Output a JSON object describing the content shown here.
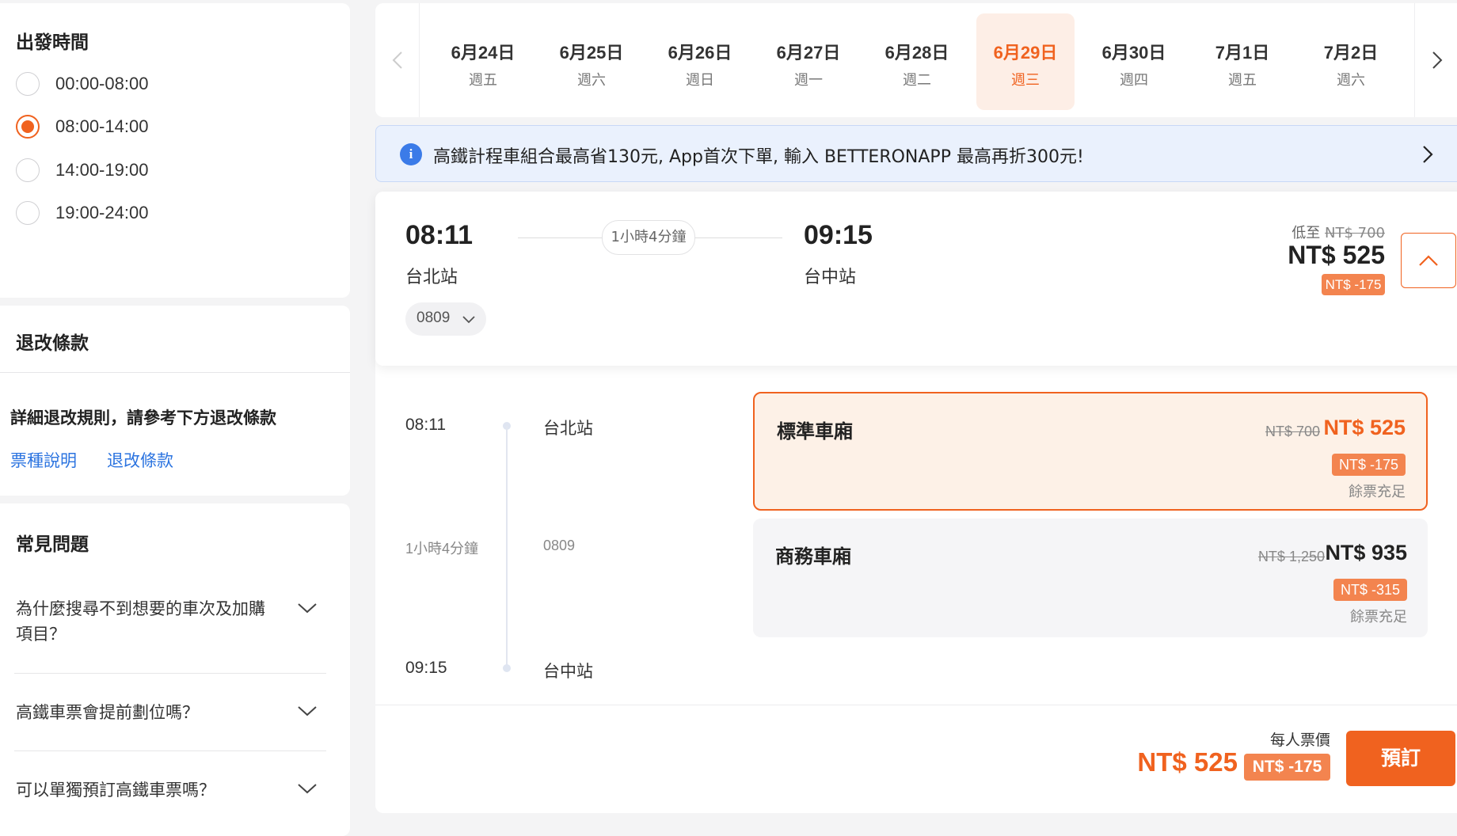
{
  "filters": {
    "departure": {
      "title": "出發時間",
      "options": [
        "00:00-08:00",
        "08:00-14:00",
        "14:00-19:00",
        "19:00-24:00"
      ],
      "selected_index": 1
    },
    "refund": {
      "title": "退改條款",
      "note": "詳細退改規則，請參考下方退改條款",
      "links": [
        "票種說明",
        "退改條款"
      ]
    },
    "faq": {
      "title": "常見問題",
      "questions": [
        "為什麼搜尋不到想要的車次及加購項目？",
        "高鐵車票會提前劃位嗎？",
        "可以單獨預訂高鐵車票嗎？"
      ]
    }
  },
  "dates": [
    {
      "date": "6月24日",
      "weekday": "週五"
    },
    {
      "date": "6月25日",
      "weekday": "週六"
    },
    {
      "date": "6月26日",
      "weekday": "週日"
    },
    {
      "date": "6月27日",
      "weekday": "週一"
    },
    {
      "date": "6月28日",
      "weekday": "週二"
    },
    {
      "date": "6月29日",
      "weekday": "週三"
    },
    {
      "date": "6月30日",
      "weekday": "週四"
    },
    {
      "date": "7月1日",
      "weekday": "週五"
    },
    {
      "date": "7月2日",
      "weekday": "週六"
    }
  ],
  "active_date_index": 5,
  "banner": {
    "text": "高鐵計程車組合最高省130元, App首次下單, 輸入 BETTERONAPP 最高再折300元!"
  },
  "train": {
    "depart_time": "08:11",
    "depart_station": "台北站",
    "arrive_time": "09:15",
    "arrive_station": "台中站",
    "duration": "1小時4分鐘",
    "train_no": "0809",
    "from_label": "低至",
    "original_price": "NT$ 700",
    "price": "NT$ 525",
    "discount": "NT$ -175"
  },
  "classes": [
    {
      "name": "標準車廂",
      "original": "NT$ 700",
      "price": "NT$ 525",
      "discount": "NT$ -175",
      "availability": "餘票充足"
    },
    {
      "name": "商務車廂",
      "original": "NT$ 1,250",
      "price": "NT$ 935",
      "discount": "NT$ -315",
      "availability": "餘票充足"
    }
  ],
  "footer": {
    "per_person_label": "每人票價",
    "price": "NT$ 525",
    "discount": "NT$ -175",
    "book_label": "預訂"
  },
  "colors": {
    "accent": "#f0621f",
    "badge": "#f3844f",
    "link": "#2c74e0",
    "info": "#3b7be8"
  }
}
